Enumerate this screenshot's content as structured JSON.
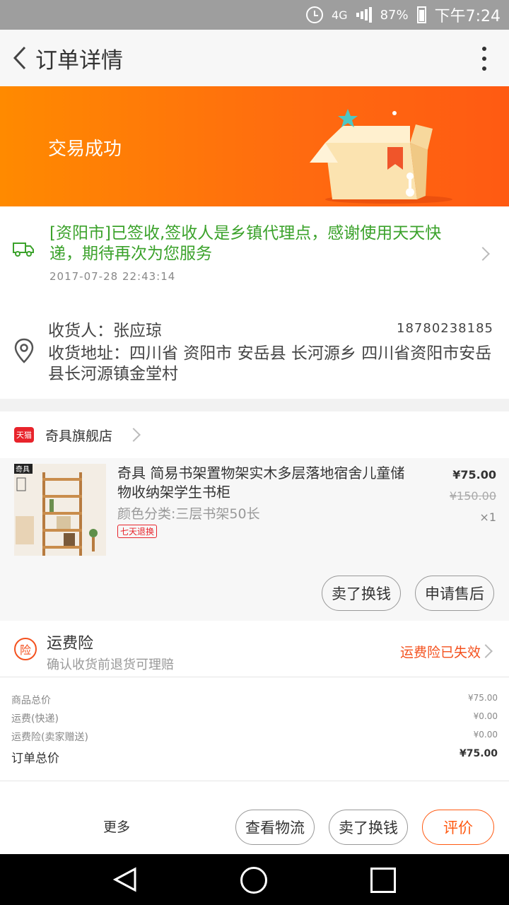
{
  "status_bar": {
    "network": "4G",
    "battery": "87%",
    "time": "下午7:24"
  },
  "nav": {
    "title": "订单详情"
  },
  "banner": {
    "status": "交易成功"
  },
  "logistics": {
    "message": "[资阳市]已签收,签收人是乡镇代理点，感谢使用天天快递，期待再次为您服务",
    "time": "2017-07-28  22:43:14"
  },
  "address": {
    "receiver": "收货人：张应琼",
    "phone": "18780238185",
    "address": "收货地址：四川省 资阳市 安岳县 长河源乡 四川省资阳市安岳县长河源镇金堂村"
  },
  "store": {
    "badge": "天猫",
    "name": "奇具旗舰店"
  },
  "product": {
    "image_brand": "奇具",
    "title": "奇具 简易书架置物架实木多层落地宿舍儿童储物收纳架学生书柜",
    "sku": "颜色分类:三层书架50长",
    "badge": "七天退换",
    "price": "¥75.00",
    "original_price": "¥150.00",
    "quantity": "×1",
    "buttons": [
      "卖了换钱",
      "申请售后"
    ]
  },
  "insurance": {
    "icon_text": "险",
    "title": "运费险",
    "subtitle": "确认收货前退货可理赔",
    "status": "运费险已失效"
  },
  "totals": {
    "rows": [
      {
        "label": "商品总价",
        "value": "¥75.00"
      },
      {
        "label": "运费(快递)",
        "value": "¥0.00"
      },
      {
        "label": "运费险(卖家赠送)",
        "value": "¥0.00"
      }
    ],
    "total_label": "订单总价",
    "total_value": "¥75.00"
  },
  "actions": {
    "more": "更多",
    "buttons": [
      "查看物流",
      "卖了换钱",
      "评价"
    ]
  },
  "colors": {
    "accent": "#ff5a12",
    "banner_start": "#ff8a00",
    "logistics_green": "#3ba22b",
    "tmall_red": "#e8232b"
  }
}
